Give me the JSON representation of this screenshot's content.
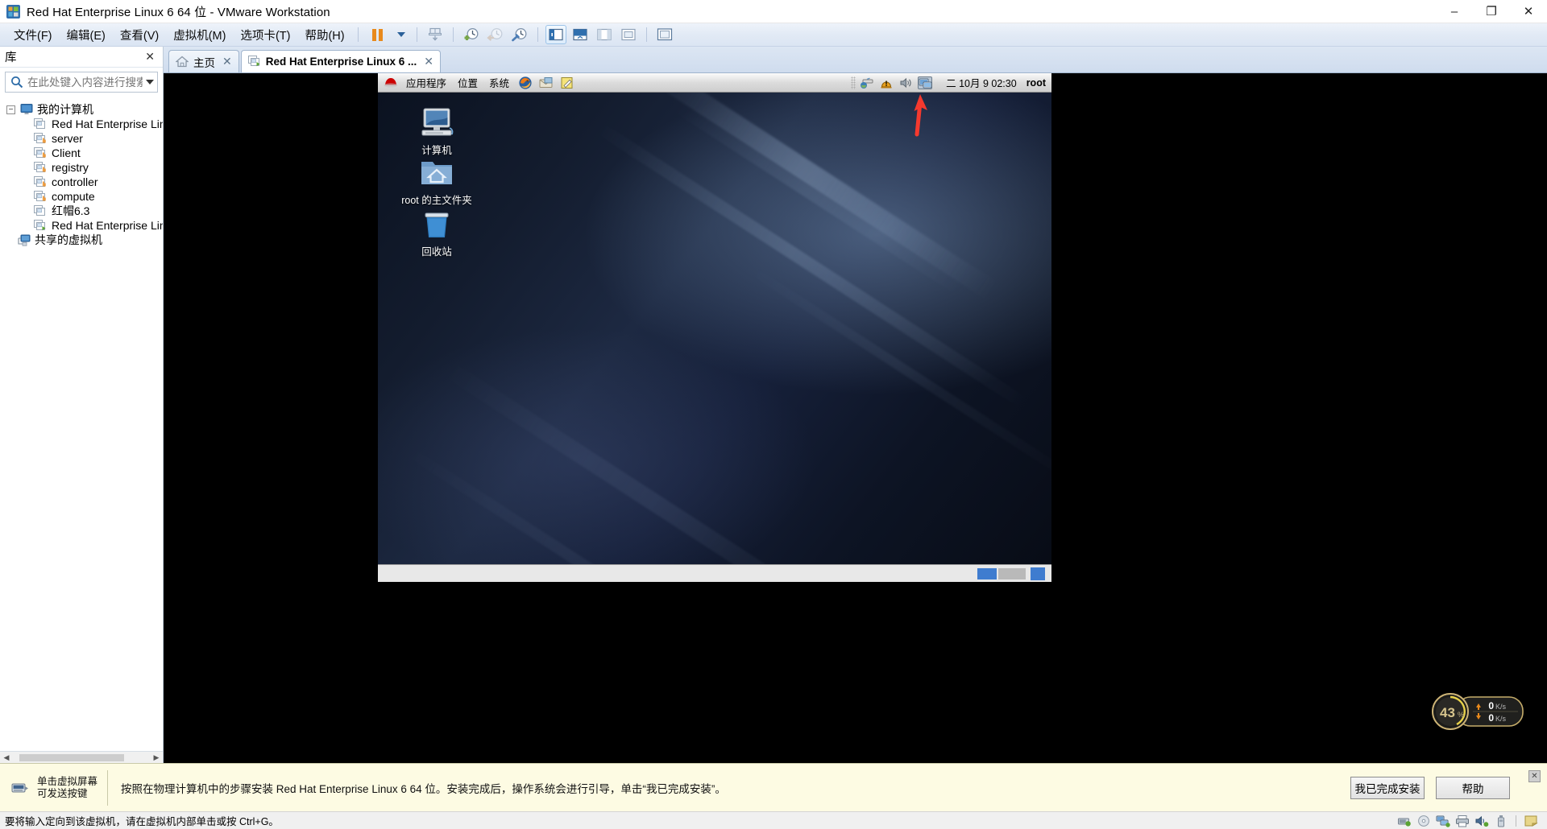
{
  "window": {
    "title": "Red Hat Enterprise Linux 6 64 位 - VMware Workstation",
    "app_icon": "vmware-logo-icon",
    "minimize": "–",
    "maximize": "❐",
    "close": "✕"
  },
  "menubar": {
    "items": [
      {
        "label": "文件(F)",
        "name": "menu-file"
      },
      {
        "label": "编辑(E)",
        "name": "menu-edit"
      },
      {
        "label": "查看(V)",
        "name": "menu-view"
      },
      {
        "label": "虚拟机(M)",
        "name": "menu-vm"
      },
      {
        "label": "选项卡(T)",
        "name": "menu-tabs"
      },
      {
        "label": "帮助(H)",
        "name": "menu-help"
      }
    ],
    "toolbar": [
      {
        "name": "pause-button",
        "icon": "pause-icon"
      },
      {
        "name": "power-dropdown-button",
        "icon": "chevron-down-icon"
      },
      {
        "name": "unity-button",
        "icon": "unity-icon"
      },
      {
        "name": "snapshot-take-button",
        "icon": "clock-plus-icon"
      },
      {
        "name": "snapshot-revert-button",
        "icon": "clock-back-icon"
      },
      {
        "name": "snapshot-manager-button",
        "icon": "clock-wrench-icon"
      },
      {
        "name": "show-library-button",
        "icon": "sidebar-panel-icon"
      },
      {
        "name": "show-console-view-button",
        "icon": "console-view-icon"
      },
      {
        "name": "show-thumbnail-bar-button",
        "icon": "thumbnail-bar-icon"
      },
      {
        "name": "full-screen-button",
        "icon": "fullscreen-icon"
      },
      {
        "name": "stretch-guest-button",
        "icon": "stretch-icon"
      }
    ]
  },
  "library": {
    "title": "库",
    "close_label": "✕",
    "search": {
      "placeholder": "在此处键入内容进行搜索",
      "value": "",
      "icon": "search-icon",
      "dropdown_icon": "chevron-down-icon"
    },
    "tree": [
      {
        "label": "我的计算机",
        "level": 0,
        "icon": "computer-icon",
        "expanded": true,
        "twisty": "−"
      },
      {
        "label": "Red Hat Enterprise Linu",
        "level": 1,
        "icon": "vm-icon"
      },
      {
        "label": "server",
        "level": 1,
        "icon": "vm-icon"
      },
      {
        "label": "Client",
        "level": 1,
        "icon": "vm-icon"
      },
      {
        "label": "registry",
        "level": 1,
        "icon": "vm-icon"
      },
      {
        "label": "controller",
        "level": 1,
        "icon": "vm-icon"
      },
      {
        "label": "compute",
        "level": 1,
        "icon": "vm-icon"
      },
      {
        "label": "红帽6.3",
        "level": 1,
        "icon": "vm-icon"
      },
      {
        "label": "Red Hat Enterprise Linu",
        "level": 1,
        "icon": "vm-running-icon"
      },
      {
        "label": "共享的虚拟机",
        "level": 0,
        "icon": "shared-vms-icon"
      }
    ],
    "scrollbar": {
      "left_arrow": "◀",
      "right_arrow": "▶"
    }
  },
  "tabs": [
    {
      "label": "主页",
      "icon": "home-icon",
      "close": "✕",
      "active": false,
      "name": "tab-home"
    },
    {
      "label": "Red Hat Enterprise Linux 6 ...",
      "icon": "vm-running-icon",
      "close": "✕",
      "active": true,
      "name": "tab-rhel"
    }
  ],
  "guest": {
    "panel": {
      "menus": [
        "应用程序",
        "位置",
        "系统"
      ],
      "logo_icon": "redhat-hat-icon",
      "launchers": [
        {
          "name": "firefox-launcher",
          "icon": "firefox-icon"
        },
        {
          "name": "evolution-launcher",
          "icon": "email-icon"
        },
        {
          "name": "text-editor-launcher",
          "icon": "notepad-icon"
        }
      ],
      "tray": [
        {
          "name": "network-applet",
          "icon": "network-icon"
        },
        {
          "name": "update-applet",
          "icon": "alert-icon"
        },
        {
          "name": "volume-applet",
          "icon": "speaker-icon"
        },
        {
          "name": "display-applet",
          "icon": "display-icon"
        }
      ],
      "clock": "二 10月  9 02:30",
      "user": "root"
    },
    "desktop_icons": [
      {
        "label": "计算机",
        "icon": "computer-desktop-icon",
        "name": "desktop-icon-computer"
      },
      {
        "label": "root 的主文件夹",
        "icon": "home-folder-icon",
        "name": "desktop-icon-home"
      },
      {
        "label": "回收站",
        "icon": "trash-icon",
        "name": "desktop-icon-trash"
      }
    ],
    "annotation": {
      "type": "arrow",
      "color": "#f5392e",
      "points_to": "display-applet"
    },
    "floating_widget": {
      "cpu_percent": "43",
      "percent_symbol": "%",
      "upload": "0",
      "download": "0",
      "unit": "K/s",
      "up_arrow": "▲",
      "down_arrow": "▼"
    }
  },
  "notice": {
    "icon": "keyboard-icon",
    "hint_line1": "单击虚拟屏幕",
    "hint_line2": "可发送按键",
    "message": "按照在物理计算机中的步骤安装 Red Hat Enterprise Linux 6 64 位。安装完成后，操作系统会进行引导，单击“我已完成安装”。",
    "buttons": [
      {
        "label": "我已完成安装",
        "name": "finished-install-button"
      },
      {
        "label": "帮助",
        "name": "help-button"
      }
    ],
    "close": "✕"
  },
  "statusbar": {
    "text": "要将输入定向到该虚拟机，请在虚拟机内部单击或按 Ctrl+G。",
    "devices": [
      {
        "name": "hard-disk-status-icon",
        "icon": "disk-icon"
      },
      {
        "name": "cdrom-status-icon",
        "icon": "cd-icon"
      },
      {
        "name": "network-status-icon",
        "icon": "network-icon"
      },
      {
        "name": "printer-status-icon",
        "icon": "printer-icon"
      },
      {
        "name": "sound-status-icon",
        "icon": "sound-icon"
      },
      {
        "name": "usb-status-icon",
        "icon": "usb-icon"
      },
      {
        "name": "message-log-icon",
        "icon": "note-icon"
      }
    ]
  },
  "colors": {
    "accent_orange": "#e8891c",
    "annotation_red": "#f5392e",
    "notice_bg": "#fdfbe3",
    "titlebar_bg": "#ffffff"
  }
}
